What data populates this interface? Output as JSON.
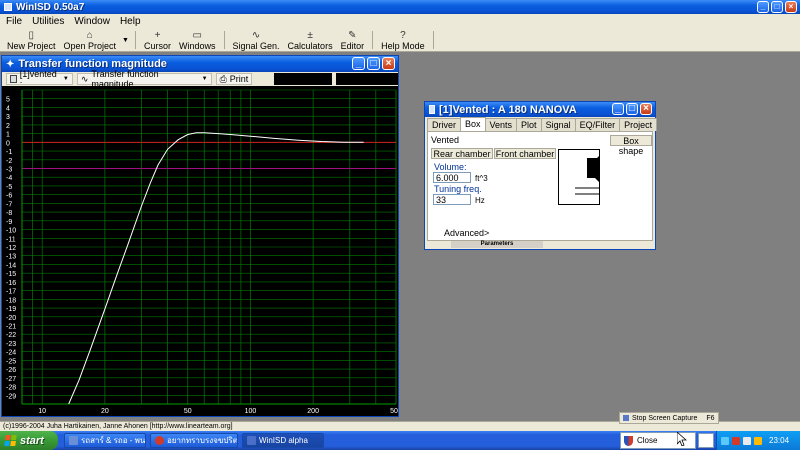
{
  "app": {
    "title": "WinISD 0.50a7",
    "menu": [
      "File",
      "Utilities",
      "Window",
      "Help"
    ],
    "toolbar": [
      {
        "label": "New Project",
        "icon": "new-project-icon",
        "glyph": "▯"
      },
      {
        "label": "Open Project",
        "icon": "open-folder-icon",
        "glyph": "⌂"
      },
      {
        "label": "Cursor",
        "icon": "cursor-icon",
        "glyph": "+"
      },
      {
        "label": "Windows",
        "icon": "windows-icon",
        "glyph": "▭"
      },
      {
        "label": "Signal Gen.",
        "icon": "sine-wave-icon",
        "glyph": "∿"
      },
      {
        "label": "Calculators",
        "icon": "calculator-icon",
        "glyph": "±"
      },
      {
        "label": "Editor",
        "icon": "editor-icon",
        "glyph": "✎"
      },
      {
        "label": "Help Mode",
        "icon": "help-icon",
        "glyph": "?"
      }
    ],
    "status": "(c)1996-2004 Juha Hartikainen, Janne Ahonen [http://www.linearteam.org]"
  },
  "tf_window": {
    "title": "Transfer function magnitude",
    "project_dropdown": "[1]vented :",
    "view_dropdown": "Transfer function magnitude",
    "print_label": "Print"
  },
  "chart_data": {
    "type": "line",
    "title": "",
    "xlabel": "",
    "ylabel": "",
    "x_scale": "log",
    "xlim": [
      8,
      500
    ],
    "ylim": [
      -30,
      6
    ],
    "x_ticks": [
      10,
      20,
      50,
      100,
      200,
      500
    ],
    "y_ticks": [
      5,
      4,
      3,
      2,
      1,
      0,
      -1,
      -2,
      -3,
      -4,
      -5,
      -6,
      -7,
      -8,
      -9,
      -10,
      -11,
      -12,
      -13,
      -14,
      -15,
      -16,
      -17,
      -18,
      -19,
      -20,
      -21,
      -22,
      -23,
      -24,
      -25,
      -26,
      -27,
      -28,
      -29
    ],
    "grid": true,
    "reference_lines": [
      0,
      -3
    ],
    "series": [
      {
        "color": "#ffffff",
        "x": [
          13.4,
          15,
          17,
          20,
          23,
          26,
          30,
          33,
          36,
          40,
          45,
          50,
          55,
          60,
          70,
          80,
          100,
          130,
          170,
          220,
          280,
          350
        ],
        "y": [
          -30,
          -27.3,
          -23.8,
          -19.1,
          -15.0,
          -11.5,
          -7.3,
          -4.7,
          -2.6,
          -0.8,
          0.3,
          0.9,
          1.1,
          1.1,
          1.0,
          0.9,
          0.7,
          0.45,
          0.25,
          0.1,
          0.02,
          0
        ]
      }
    ]
  },
  "vented_window": {
    "title": "[1]Vented : A 180 NANOVA",
    "tabs": [
      "Driver",
      "Box",
      "Vents",
      "Plot",
      "Signal",
      "EQ/Filter",
      "Project"
    ],
    "active_tab": "Box",
    "group_label": "Vented",
    "box_shape_button": "Box shape",
    "rear_chamber_button": "Rear chamber",
    "front_chamber_button": "Front chamber",
    "volume_label": "Volume:",
    "volume_value": "6.000",
    "volume_unit": "ft^3",
    "tuning_label": "Tuning freq.",
    "tuning_value": "33",
    "tuning_unit": "Hz",
    "advanced_label": "Advanced>",
    "parameters_label": "Parameters"
  },
  "capture_popup": {
    "label": "Stop Screen Capture",
    "shortcut": "F6"
  },
  "taskbar": {
    "start_label": "start",
    "items": [
      {
        "label": "รถสาร์ & รถอ - พนพหน่...",
        "icon_color": "#6b8fd6"
      },
      {
        "label": "อยากทราบรงจขปริตผล...",
        "icon_color": "#d23a2a"
      },
      {
        "label": "WinISD alpha",
        "icon_color": "#4a6fc8"
      }
    ],
    "close_label": "Close",
    "clock": "23:04"
  }
}
